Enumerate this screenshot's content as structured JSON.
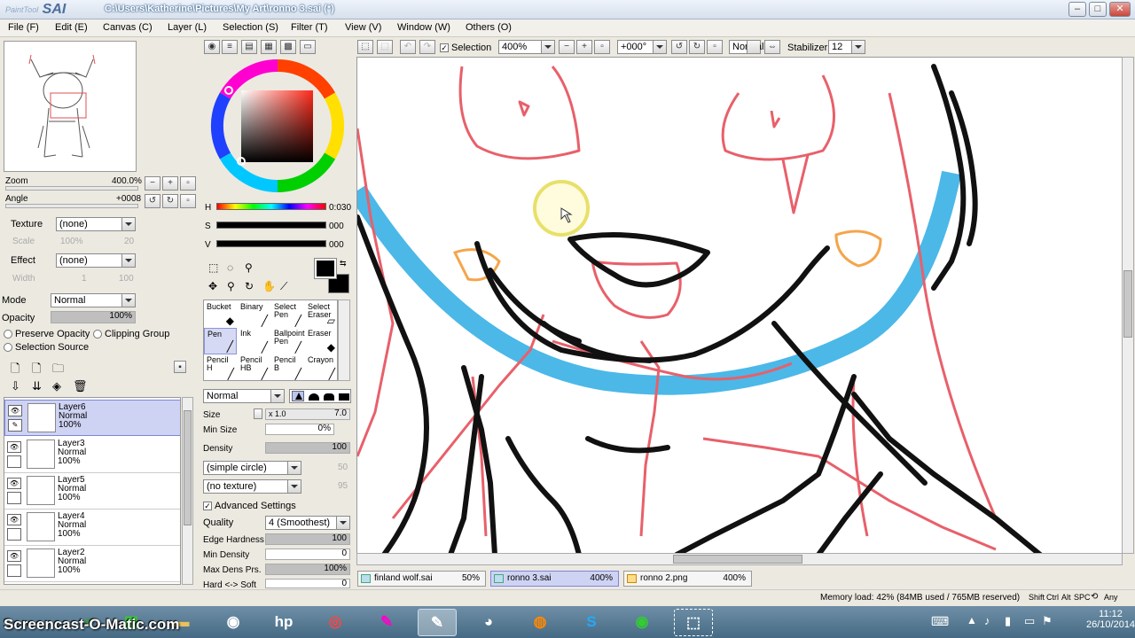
{
  "window": {
    "app_name": "PaintTool",
    "app_logo": "SAI",
    "title": "C:\\Users\\Katherine\\Pictures\\My Art\\ronno 3.sai (*)"
  },
  "menu": [
    "File (F)",
    "Edit (E)",
    "Canvas (C)",
    "Layer (L)",
    "Selection (S)",
    "Filter (T)",
    "View (V)",
    "Window (W)",
    "Others (O)"
  ],
  "navigator": {
    "zoom_label": "Zoom",
    "zoom_value": "400.0%",
    "angle_label": "Angle",
    "angle_value": "+0008"
  },
  "layer_props": {
    "texture_label": "Texture",
    "texture_value": "(none)",
    "scale_label": "Scale",
    "scale_value": "100%",
    "scale_num": "20",
    "effect_label": "Effect",
    "effect_value": "(none)",
    "width_label": "Width",
    "width_value": "1",
    "width_num": "100",
    "mode_label": "Mode",
    "mode_value": "Normal",
    "opacity_label": "Opacity",
    "opacity_value": "100%",
    "preserve_opacity": "Preserve Opacity",
    "clipping_group": "Clipping Group",
    "selection_source": "Selection Source"
  },
  "layers": [
    {
      "name": "Layer6",
      "mode": "Normal",
      "opacity": "100%",
      "active": true
    },
    {
      "name": "Layer3",
      "mode": "Normal",
      "opacity": "100%"
    },
    {
      "name": "Layer5",
      "mode": "Normal",
      "opacity": "100%"
    },
    {
      "name": "Layer4",
      "mode": "Normal",
      "opacity": "100%"
    },
    {
      "name": "Layer2",
      "mode": "Normal",
      "opacity": "100%"
    }
  ],
  "color": {
    "h_label": "H",
    "h_value": "0:030",
    "s_label": "S",
    "s_value": "000",
    "v_label": "V",
    "v_value": "000",
    "primary": "#000000",
    "secondary": "#000000"
  },
  "tools": [
    {
      "label": "Bucket",
      "icon": "bucket-icon",
      "glyph": "◆"
    },
    {
      "label": "Binary",
      "icon": "binary-pen-icon",
      "glyph": "╱"
    },
    {
      "label": "Select Pen",
      "icon": "select-pen-icon",
      "glyph": "╱"
    },
    {
      "label": "Select Eraser",
      "icon": "select-eraser-icon",
      "glyph": "▱"
    },
    {
      "label": "Pen",
      "icon": "pen-icon",
      "glyph": "╱",
      "active": true
    },
    {
      "label": "Ink",
      "icon": "ink-icon",
      "glyph": "╱"
    },
    {
      "label": "Ballpoint Pen",
      "icon": "ballpoint-icon",
      "glyph": "╱"
    },
    {
      "label": "Eraser",
      "icon": "eraser-icon",
      "glyph": "◆"
    },
    {
      "label": "Pencil H",
      "icon": "pencil-h-icon",
      "glyph": "╱"
    },
    {
      "label": "Pencil HB",
      "icon": "pencil-hb-icon",
      "glyph": "╱"
    },
    {
      "label": "Pencil B",
      "icon": "pencil-b-icon",
      "glyph": "╱"
    },
    {
      "label": "Crayon",
      "icon": "crayon-icon",
      "glyph": "╱"
    }
  ],
  "brush": {
    "mode_value": "Normal",
    "size_label": "Size",
    "size_mult": "x 1.0",
    "size_value": "7.0",
    "min_size_label": "Min Size",
    "min_size_value": "0%",
    "density_label": "Density",
    "density_value": "100",
    "shape_value": "(simple circle)",
    "shape_num": "50",
    "texture_value": "(no texture)",
    "texture_num": "95",
    "advanced_label": "Advanced Settings",
    "quality_label": "Quality",
    "quality_value": "4 (Smoothest)",
    "edge_label": "Edge Hardness",
    "edge_value": "100",
    "min_density_label": "Min Density",
    "min_density_value": "0",
    "max_dens_label": "Max Dens Prs.",
    "max_dens_value": "100%",
    "hard_soft_label": "Hard <-> Soft",
    "hard_soft_value": "0"
  },
  "toolbar": {
    "selection_label": "Selection",
    "zoom_value": "400%",
    "rotation_value": "+000°",
    "blend_value": "Normal",
    "stabilizer_label": "Stabilizer",
    "stabilizer_value": "12"
  },
  "tabs": [
    {
      "name": "finland wolf.sai",
      "pct": "50%"
    },
    {
      "name": "ronno 3.sai",
      "pct": "400%",
      "active": true
    },
    {
      "name": "ronno 2.png",
      "pct": "400%"
    }
  ],
  "status": {
    "memory": "Memory load: 42% (84MB used / 765MB reserved)",
    "keys": [
      "Shift",
      "Ctrl",
      "Alt",
      "SPC"
    ],
    "any": "Any"
  },
  "taskbar": {
    "watermark": "Screencast-O-Matic.com",
    "time": "11:12",
    "date": "26/10/2014"
  }
}
